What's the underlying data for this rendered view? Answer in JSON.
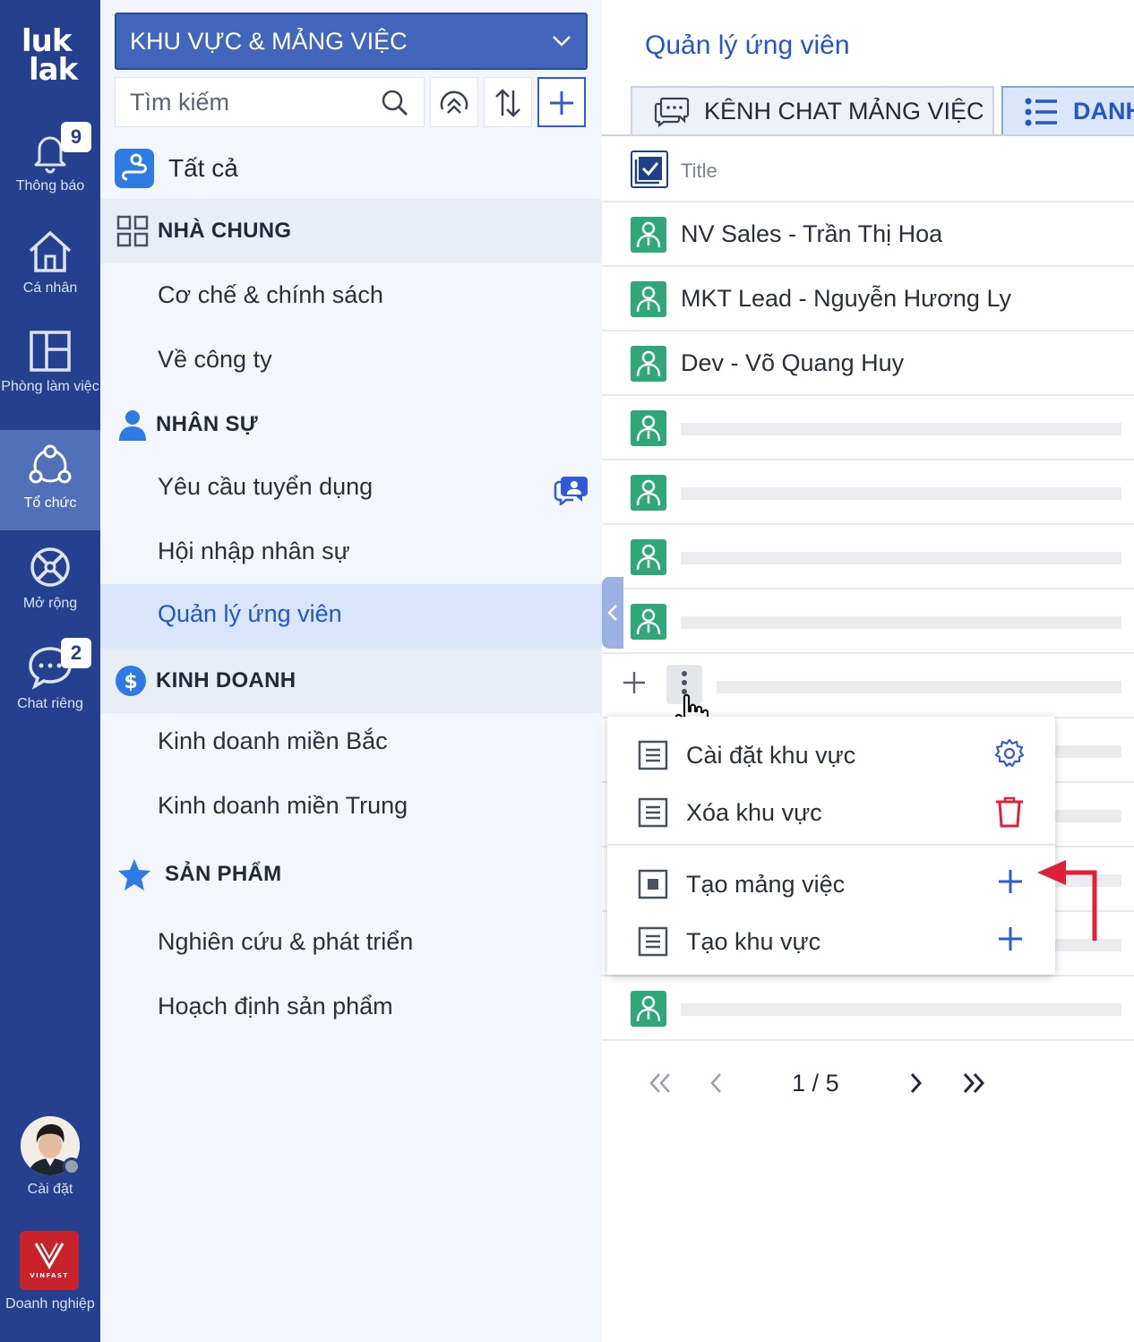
{
  "brand": {
    "logo_line1": "luk",
    "logo_line2": "lak"
  },
  "rail": {
    "items": [
      {
        "label": "Thông báo",
        "badge": "9"
      },
      {
        "label": "Cá nhân"
      },
      {
        "label": "Phòng làm việc"
      },
      {
        "label": "Tổ chức",
        "active": true
      },
      {
        "label": "Mở rộng"
      },
      {
        "label": "Chat riêng",
        "badge": "2"
      }
    ],
    "settings_label": "Cài đặt",
    "company_label": "Doanh nghiệp",
    "company_logo_text": "VINFAST"
  },
  "panel": {
    "selector_label": "KHU VỰC & MẢNG VIỆC",
    "search_placeholder": "Tìm kiếm",
    "all_label": "Tất cả",
    "sections": [
      {
        "label": "NHÀ CHUNG",
        "icon": "grid-icon",
        "items": [
          "Cơ chế & chính sách",
          "Về công ty"
        ]
      },
      {
        "label": "NHÂN SỰ",
        "icon": "person-icon",
        "items": [
          "Yêu cầu tuyển dụng",
          "Hội nhập nhân sự",
          "Quản lý ứng viên"
        ]
      },
      {
        "label": "KINH DOANH",
        "icon": "dollar-icon",
        "items": [
          "Kinh doanh miền Bắc",
          "Kinh doanh miền Trung"
        ]
      },
      {
        "label": "SẢN PHẨM",
        "icon": "star-icon",
        "items": [
          "Nghiên cứu & phát triển",
          "Hoạch định sản phẩm"
        ]
      }
    ],
    "selected_item": "Quản lý ứng viên"
  },
  "main": {
    "title": "Quản lý ứng viên",
    "tabs": [
      {
        "label": "KÊNH CHAT MẢNG VIỆC"
      },
      {
        "label": "DANH",
        "active": true
      }
    ],
    "table": {
      "header": "Title",
      "rows": [
        "NV Sales - Trần Thị Hoa",
        "MKT Lead - Nguyễn Hương Ly",
        "Dev - Võ Quang Huy"
      ]
    },
    "pagination": {
      "current": "1",
      "sep": "/",
      "total": "5"
    }
  },
  "context_menu": {
    "items": [
      {
        "label": "Cài đặt khu vực",
        "action_icon": "gear-icon"
      },
      {
        "label": "Xóa khu vực",
        "action_icon": "trash-icon"
      },
      {
        "label": "Tạo mảng việc",
        "action_icon": "plus-icon"
      },
      {
        "label": "Tạo khu vực",
        "action_icon": "plus-icon"
      }
    ]
  },
  "colors": {
    "rail_bg": "#24408e",
    "accent": "#2256c9",
    "selector_bg": "#4366bd",
    "danger": "#e0203a",
    "user_icon": "#2fa77b"
  }
}
